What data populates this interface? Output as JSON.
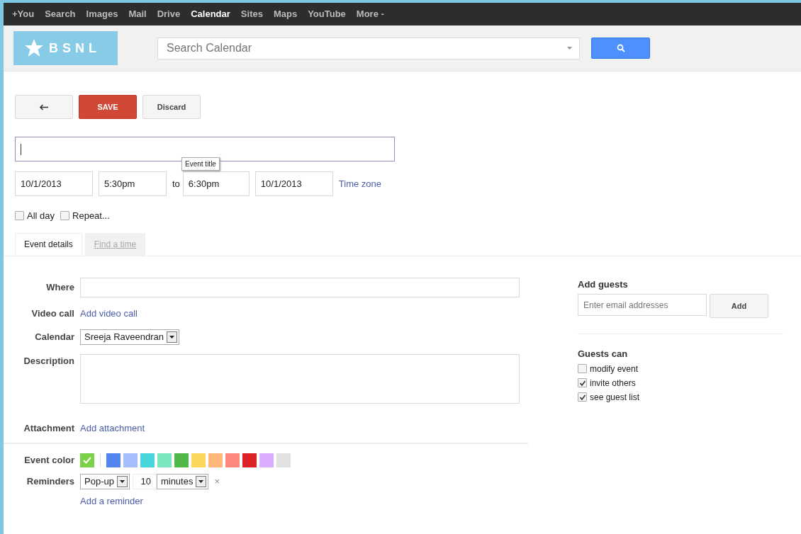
{
  "top_nav": [
    {
      "label": "+You",
      "selected": false
    },
    {
      "label": "Search",
      "selected": false
    },
    {
      "label": "Images",
      "selected": false
    },
    {
      "label": "Mail",
      "selected": false
    },
    {
      "label": "Drive",
      "selected": false
    },
    {
      "label": "Calendar",
      "selected": true
    },
    {
      "label": "Sites",
      "selected": false
    },
    {
      "label": "Maps",
      "selected": false
    },
    {
      "label": "YouTube",
      "selected": false
    },
    {
      "label": "More -",
      "selected": false
    }
  ],
  "logo": {
    "text": "BSNL"
  },
  "search": {
    "placeholder": "Search Calendar"
  },
  "toolbar": {
    "save": "SAVE",
    "discard": "Discard"
  },
  "title_field": {
    "tooltip": "Event title"
  },
  "when": {
    "start_date": "10/1/2013",
    "start_time": "5:30pm",
    "to": "to",
    "end_time": "6:30pm",
    "end_date": "10/1/2013",
    "time_zone": "Time zone"
  },
  "options": [
    {
      "label": "All day",
      "checked": false
    },
    {
      "label": "Repeat...",
      "checked": false
    }
  ],
  "tabs": [
    {
      "label": "Event details",
      "selected": true
    },
    {
      "label": "Find a time",
      "selected": false
    }
  ],
  "details": {
    "where_label": "Where",
    "video_label": "Video call",
    "video_link": "Add video call",
    "calendar_label": "Calendar",
    "calendar_value": "Sreeja Raveendran",
    "description_label": "Description",
    "attachment_label": "Attachment",
    "attachment_link": "Add attachment",
    "color_label": "Event color",
    "reminders_label": "Reminders",
    "reminder_method": "Pop-up",
    "reminder_amount": "10",
    "reminder_unit": "minutes",
    "remove": "×",
    "add_reminder": "Add a reminder"
  },
  "event_colors": [
    {
      "color": "#7bd148",
      "selected": true
    },
    {
      "color": "#5484ed",
      "selected": false
    },
    {
      "color": "#a4bdfc",
      "selected": false
    },
    {
      "color": "#46d6db",
      "selected": false
    },
    {
      "color": "#7ae7bf",
      "selected": false
    },
    {
      "color": "#51b749",
      "selected": false
    },
    {
      "color": "#fbd75b",
      "selected": false
    },
    {
      "color": "#ffb878",
      "selected": false
    },
    {
      "color": "#ff887c",
      "selected": false
    },
    {
      "color": "#dc2127",
      "selected": false
    },
    {
      "color": "#dbadff",
      "selected": false
    },
    {
      "color": "#e1e1e1",
      "selected": false
    }
  ],
  "guests": {
    "title": "Add guests",
    "placeholder": "Enter email addresses",
    "add": "Add",
    "can_title": "Guests can",
    "permissions": [
      {
        "label": "modify event",
        "checked": false
      },
      {
        "label": "invite others",
        "checked": true
      },
      {
        "label": "see guest list",
        "checked": true
      }
    ]
  }
}
